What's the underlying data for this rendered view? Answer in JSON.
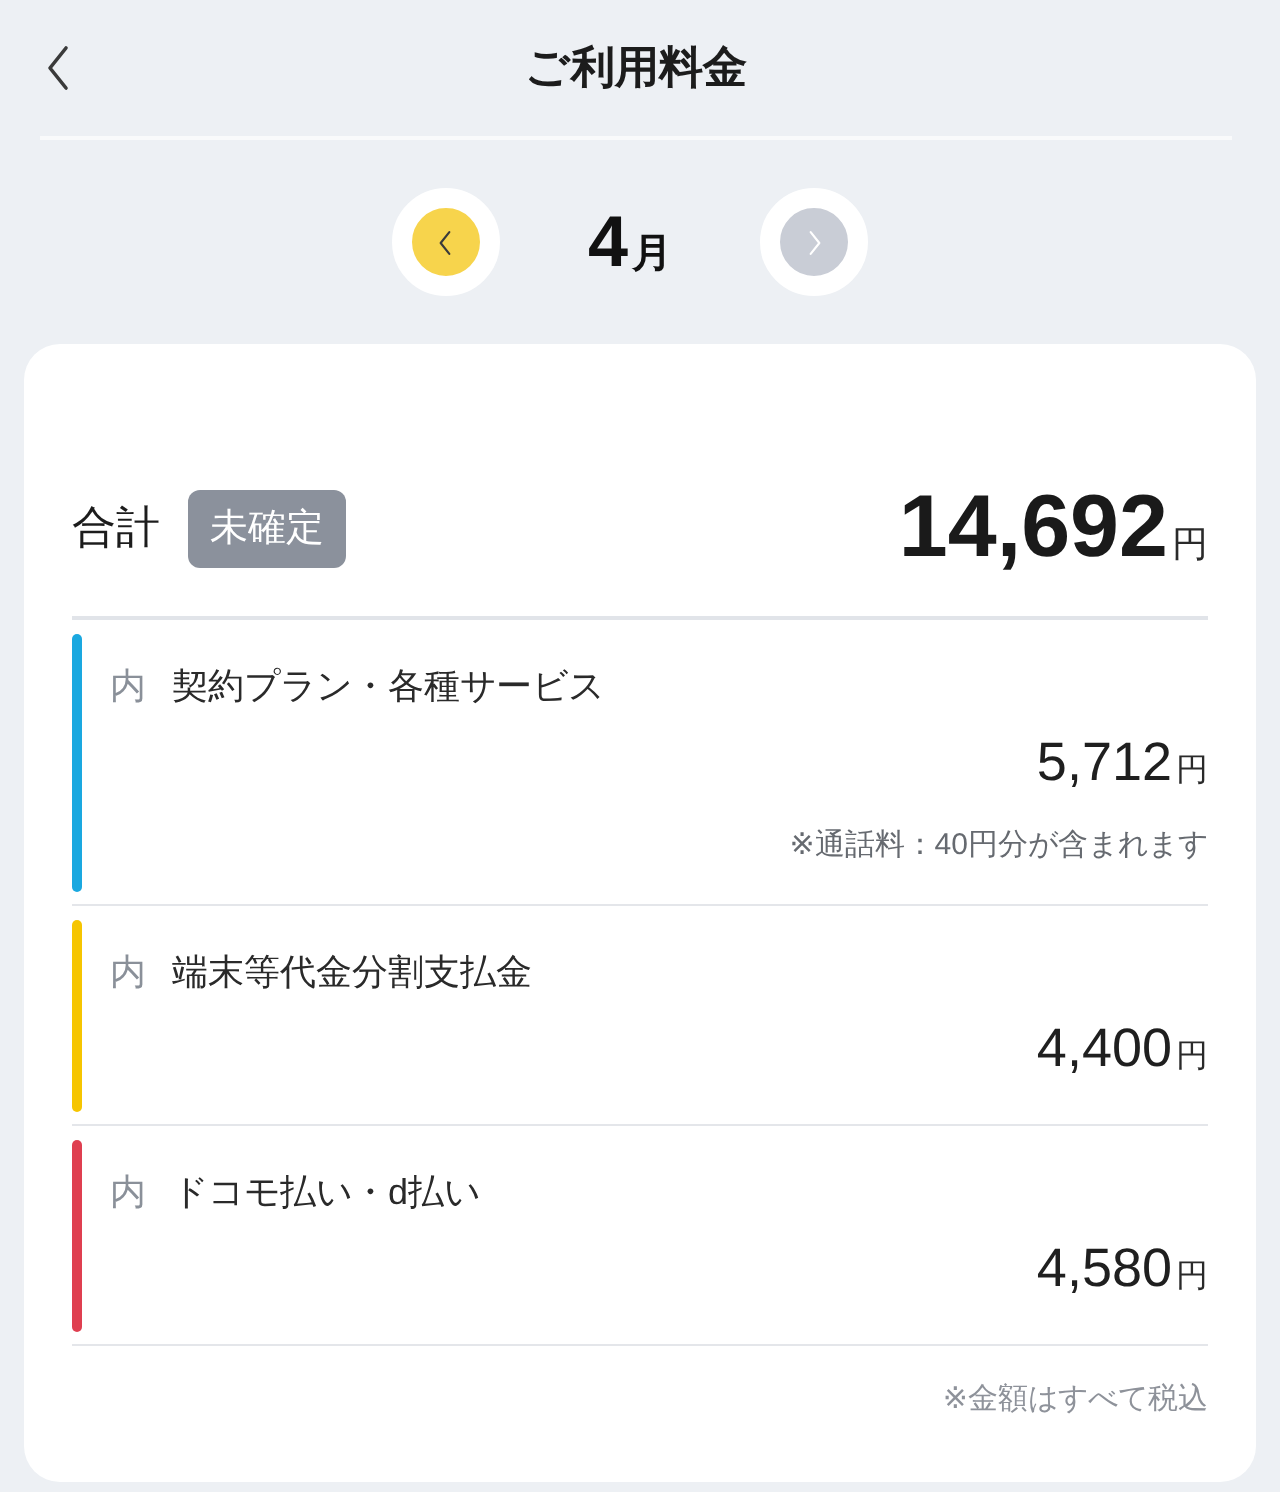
{
  "header": {
    "title": "ご利用料金"
  },
  "month_nav": {
    "prev": {
      "disabled": false
    },
    "month": {
      "number": "4",
      "unit": "月"
    },
    "next": {
      "disabled": true
    }
  },
  "summary": {
    "label": "合計",
    "badge": "未確定",
    "amount": "14,692",
    "currency": "円"
  },
  "items": [
    {
      "prefix": "内",
      "name": "契約プラン・各種サービス",
      "amount": "5,712",
      "currency": "円",
      "note": "※通話料：40円分が含まれます",
      "color": "#1aa8e0"
    },
    {
      "prefix": "内",
      "name": "端末等代金分割支払金",
      "amount": "4,400",
      "currency": "円",
      "color": "#f6c500"
    },
    {
      "prefix": "内",
      "name": "ドコモ払い・d払い",
      "amount": "4,580",
      "currency": "円",
      "color": "#df3f50"
    }
  ],
  "footnote": "※金額はすべて税込"
}
